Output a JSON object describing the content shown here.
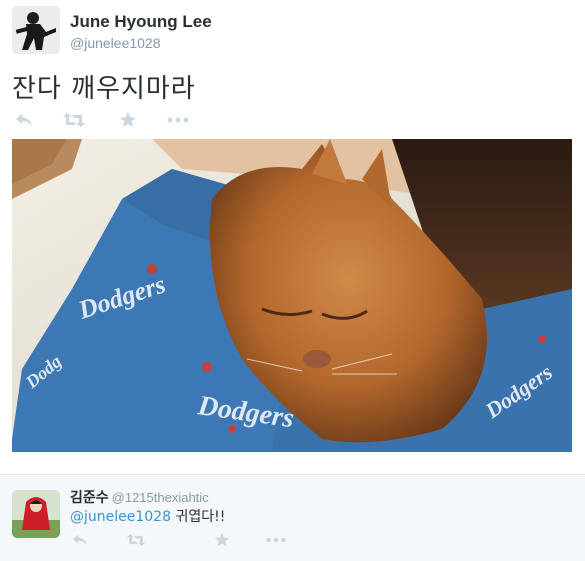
{
  "tweet": {
    "display_name": "June Hyoung Lee",
    "handle": "@junelee1028",
    "text": "잔다 깨우지마라"
  },
  "tweet_actions": {
    "reply_icon": "reply-icon",
    "retweet_icon": "retweet-icon",
    "favorite_icon": "star-icon",
    "more_icon": "more-icon"
  },
  "reply": {
    "display_name": "김준수",
    "handle": "@1215thexiahtic",
    "mention": "@junelee1028",
    "text": " 귀엽다!!"
  },
  "colors": {
    "name": "#292f33",
    "handle": "#8899a6",
    "link": "#3b94d9",
    "icon": "#ccd6dd",
    "reply_bg": "#f5f8fa"
  }
}
